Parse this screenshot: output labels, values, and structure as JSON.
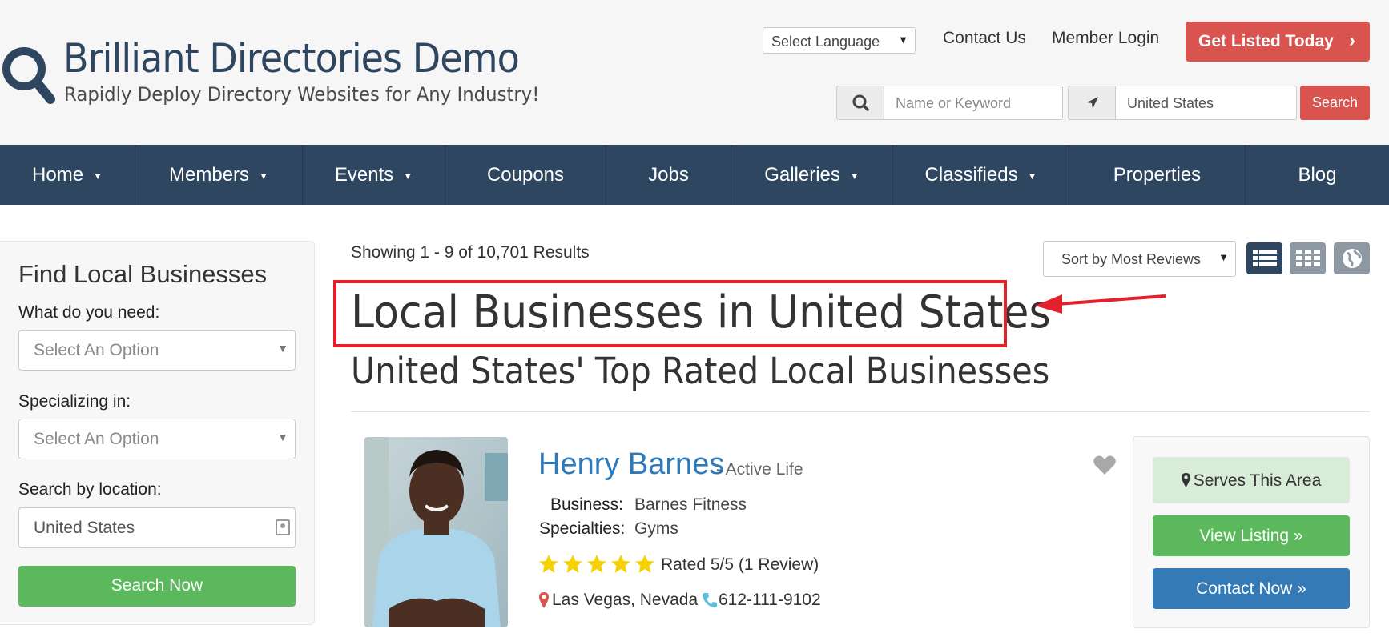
{
  "header": {
    "site_title": "Brilliant Directories Demo",
    "tagline": "Rapidly Deploy Directory Websites for Any Industry!",
    "language_select": "Select Language",
    "contact_link": "Contact Us",
    "login_link": "Member Login",
    "cta_label": "Get Listed Today",
    "search": {
      "keyword_placeholder": "Name or Keyword",
      "location_value": "United States",
      "button_label": "Search"
    }
  },
  "nav": {
    "items": [
      {
        "label": "Home",
        "dropdown": true
      },
      {
        "label": "Members",
        "dropdown": true
      },
      {
        "label": "Events",
        "dropdown": true
      },
      {
        "label": "Coupons",
        "dropdown": false
      },
      {
        "label": "Jobs",
        "dropdown": false
      },
      {
        "label": "Galleries",
        "dropdown": true
      },
      {
        "label": "Classifieds",
        "dropdown": true
      },
      {
        "label": "Properties",
        "dropdown": false
      },
      {
        "label": "Blog",
        "dropdown": false
      }
    ]
  },
  "sidebar": {
    "title": "Find Local Businesses",
    "need_label": "What do you need:",
    "need_value": "Select An Option",
    "specializing_label": "Specializing in:",
    "specializing_value": "Select An Option",
    "location_label": "Search by location:",
    "location_value": "United States",
    "button_label": "Search Now"
  },
  "results": {
    "count_text": "Showing 1 - 9 of 10,701 Results",
    "sort_value": "Sort by Most Reviews",
    "heading": "Local Businesses in United States",
    "subheading": "United States' Top Rated Local Businesses"
  },
  "listing": {
    "name": "Henry Barnes",
    "category": "- Active Life",
    "business_label": "Business:",
    "business_value": "Barnes Fitness",
    "specialties_label": "Specialties:",
    "specialties_value": "Gyms",
    "rating": 5,
    "rating_text": "Rated 5/5 (1 Review)",
    "location": "Las Vegas, Nevada",
    "phone": "612-111-9102",
    "serves_label": "Serves This Area",
    "view_label": "View Listing »",
    "contact_label": "Contact Now »"
  },
  "colors": {
    "navy": "#2f4660",
    "red": "#d9534f",
    "green": "#5cb85c",
    "blue": "#337ab7",
    "highlight": "#e3202c",
    "star": "#f7d100"
  }
}
